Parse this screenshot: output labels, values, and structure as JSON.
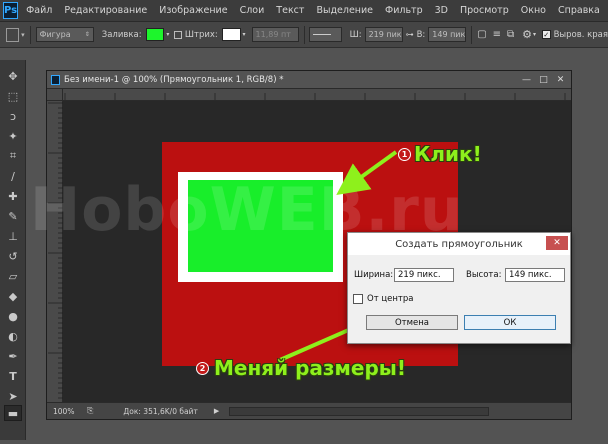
{
  "app": {
    "logo": "Ps"
  },
  "menu": [
    "Файл",
    "Редактирование",
    "Изображение",
    "Слои",
    "Текст",
    "Выделение",
    "Фильтр",
    "3D",
    "Просмотр",
    "Окно",
    "Справка"
  ],
  "options": {
    "shape_mode": "Фигура",
    "fill_label": "Заливка:",
    "stroke_label": "Штрих:",
    "stroke_size": "11,89 пт",
    "w_label": "Ш:",
    "width_value": "219 пик",
    "h_label": "В:",
    "height_value": "149 пик",
    "align_edges": "Выров. края",
    "fill_color": "#1df52c",
    "stroke_color": "#ffffff"
  },
  "document": {
    "title": "Без имени-1 @ 100% (Прямоугольник 1, RGB/8) *",
    "zoom": "100%",
    "doc_info": "Док: 351,6K/0 байт"
  },
  "canvas": {
    "background_color": "#bb1010",
    "rect_color": "#18ee2a",
    "rect_border_color": "#ffffff"
  },
  "watermark": "HoboWEB.ru",
  "dialog": {
    "title": "Создать прямоугольник",
    "close": "✕",
    "width_label": "Ширина:",
    "width_value": "219 пикс.",
    "height_label": "Высота:",
    "height_value": "149 пикс.",
    "from_center_label": "От центра",
    "cancel": "Отмена",
    "ok": "ОК"
  },
  "annotations": {
    "step1_num": "1",
    "step1_text": "Клик!",
    "step2_num": "2",
    "step2_text": "Меняй размеры!"
  }
}
